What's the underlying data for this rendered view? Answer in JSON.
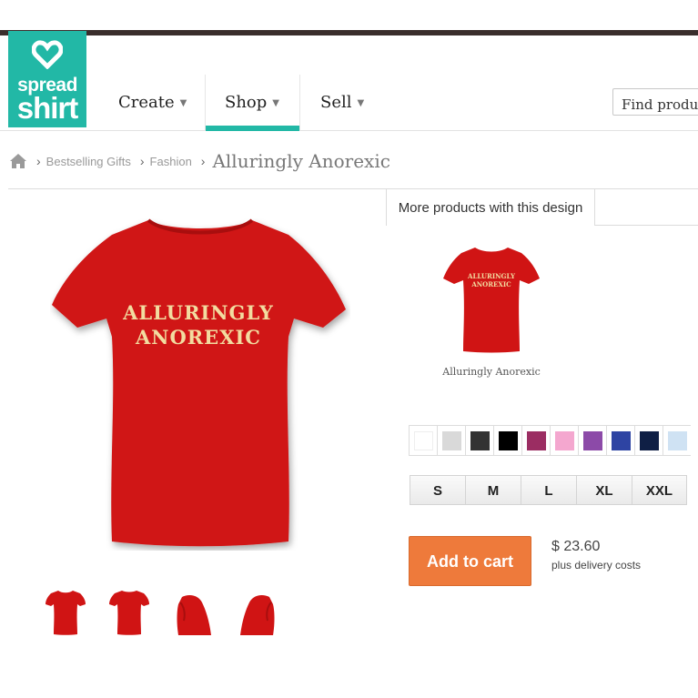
{
  "brand": {
    "line1": "spread",
    "line2": "shirt"
  },
  "nav": [
    {
      "label": "Create"
    },
    {
      "label": "Shop"
    },
    {
      "label": "Sell"
    }
  ],
  "search": {
    "placeholder": "Find products"
  },
  "breadcrumb": {
    "items": [
      "Bestselling Gifts",
      "Fashion"
    ],
    "title": "Alluringly Anorexic"
  },
  "tab": {
    "label": "More products with this design"
  },
  "design": {
    "line1": "ALLURINGLY",
    "line2": "ANOREXIC"
  },
  "related": {
    "caption": "Alluringly Anorexic"
  },
  "colors": [
    "#ffffff",
    "#d9d9d9",
    "#333333",
    "#000000",
    "#9b2d62",
    "#f4a7cf",
    "#8c4aa8",
    "#2e44a3",
    "#0f1f45",
    "#cfe2f3"
  ],
  "sizes": [
    "S",
    "M",
    "L",
    "XL",
    "XXL"
  ],
  "cart": {
    "label": "Add to cart"
  },
  "price": {
    "amount": "$ 23.60",
    "note": "plus delivery costs"
  },
  "product_color": "#d01414",
  "accent": "#22b8a6"
}
